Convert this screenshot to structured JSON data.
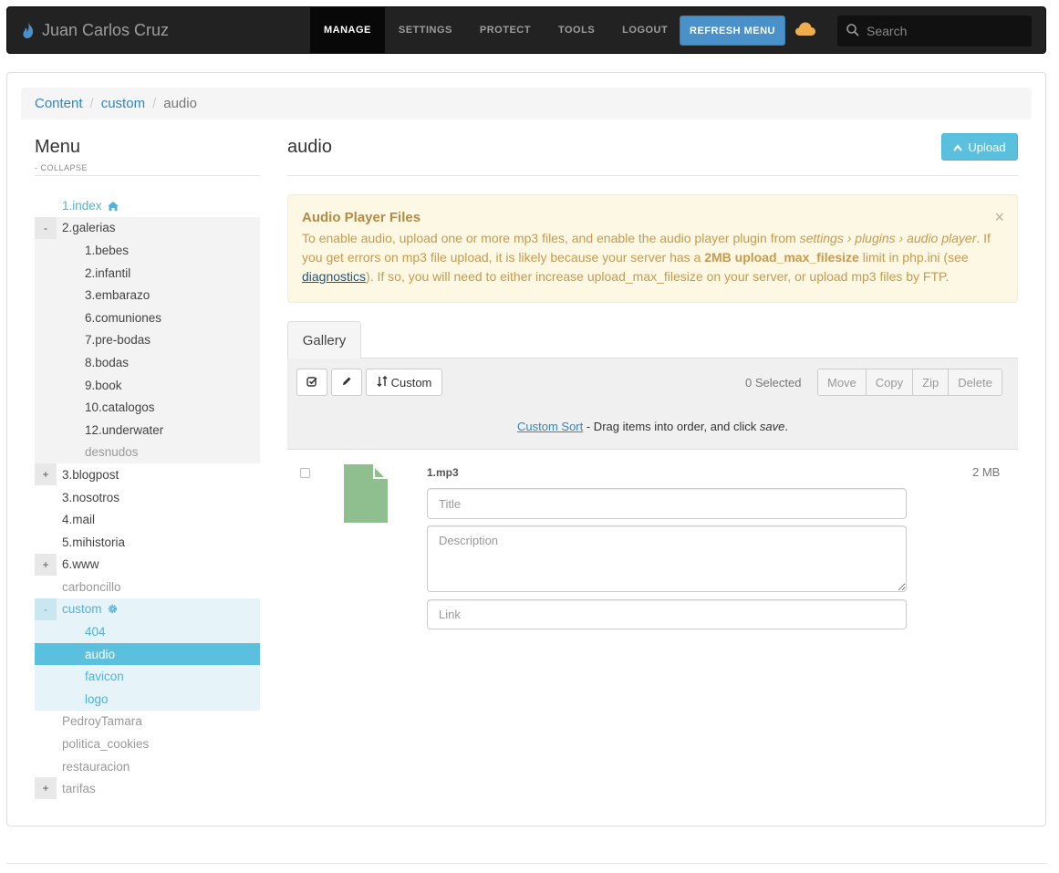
{
  "brand": {
    "name": "Juan Carlos Cruz"
  },
  "nav": {
    "manage": "MANAGE",
    "settings": "SETTINGS",
    "protect": "PROTECT",
    "tools": "TOOLS",
    "logout": "LOGOUT",
    "refresh": "REFRESH MENU"
  },
  "search": {
    "placeholder": "Search"
  },
  "breadcrumb": {
    "content": "Content",
    "custom": "custom",
    "current": "audio"
  },
  "sidebar": {
    "title": "Menu",
    "collapse": "- COLLAPSE",
    "items": [
      {
        "label": "1.index",
        "toggle": ""
      },
      {
        "label": "2.galerias",
        "toggle": "-"
      },
      {
        "label": "1.bebes"
      },
      {
        "label": "2.infantil"
      },
      {
        "label": "3.embarazo"
      },
      {
        "label": "6.comuniones"
      },
      {
        "label": "7.pre-bodas"
      },
      {
        "label": "8.bodas"
      },
      {
        "label": "9.book"
      },
      {
        "label": "10.catalogos"
      },
      {
        "label": "12.underwater"
      },
      {
        "label": "desnudos"
      },
      {
        "label": "3.blogpost",
        "toggle": "+"
      },
      {
        "label": "3.nosotros"
      },
      {
        "label": "4.mail"
      },
      {
        "label": "5.mihistoria"
      },
      {
        "label": "6.www",
        "toggle": "+"
      },
      {
        "label": "carboncillo"
      },
      {
        "label": "custom",
        "toggle": "-"
      },
      {
        "label": "404"
      },
      {
        "label": "audio"
      },
      {
        "label": "favicon"
      },
      {
        "label": "logo"
      },
      {
        "label": "PedroyTamara"
      },
      {
        "label": "politica_cookies"
      },
      {
        "label": "restauracion"
      },
      {
        "label": "tarifas",
        "toggle": "+"
      }
    ]
  },
  "content": {
    "title": "audio",
    "upload": "Upload"
  },
  "alert": {
    "title": "Audio Player Files",
    "t1": "To enable audio, upload one or more mp3 files, and enable the audio player plugin from ",
    "path": "settings › plugins › audio player",
    "t2": ". If you get errors on mp3 file upload, it is likely because your server has a ",
    "limit": "2MB upload_max_filesize",
    "t3": " limit in php.ini (see ",
    "link": "diagnostics",
    "t4": "). If so, you will need to either increase upload_max_filesize on your server, or upload mp3 files by FTP.",
    "close": "×"
  },
  "gallery": {
    "tab": "Gallery",
    "custom": "Custom",
    "selected": "0 Selected",
    "actions": {
      "move": "Move",
      "copy": "Copy",
      "zip": "Zip",
      "delete": "Delete"
    },
    "sort_link": "Custom Sort",
    "sort_text": " - Drag items into order, and click ",
    "sort_save": "save",
    "sort_end": "."
  },
  "file": {
    "name": "1.mp3",
    "size": "2 MB",
    "title_placeholder": "Title",
    "desc_placeholder": "Description",
    "link_placeholder": "Link"
  },
  "colors": {
    "accent": "#5bc0de",
    "link": "#2f87c2",
    "file_icon": "#8fbf8f"
  }
}
